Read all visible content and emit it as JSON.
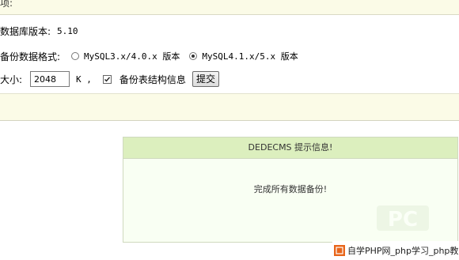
{
  "header": {
    "partial_label": "项:"
  },
  "db_version": {
    "label": "数据库版本:",
    "value": "5.10"
  },
  "backup_format": {
    "label": "备份数据格式:",
    "options": [
      {
        "label": "MySQL3.x/4.0.x 版本",
        "checked": false
      },
      {
        "label": "MySQL4.1.x/5.x 版本",
        "checked": true
      }
    ]
  },
  "volume": {
    "label": "大小:",
    "value": "2048",
    "unit": "K ,",
    "backup_structure": {
      "label": "备份表结构信息",
      "checked": true
    },
    "submit_label": "提交"
  },
  "message_box": {
    "title": "DEDECMS 提示信息!",
    "body": "完成所有数据备份!"
  },
  "watermark": {
    "text": "PC"
  },
  "footer": {
    "text": "自学PHP网_php学习_php教"
  },
  "colors": {
    "strip": "#fbfbe7",
    "box_header": "#dcefbe",
    "box_body": "#f9fff3",
    "footer_logo": "#e8651a"
  }
}
